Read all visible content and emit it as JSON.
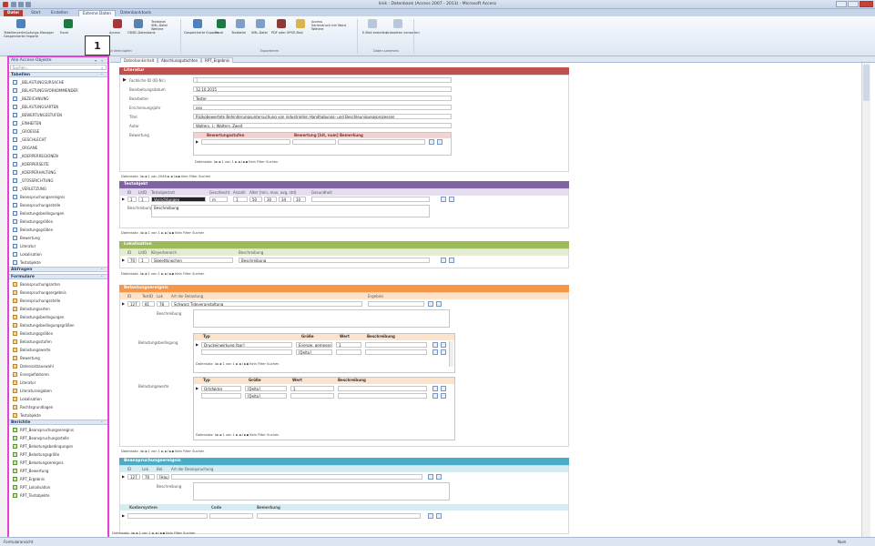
{
  "window": {
    "title": "linik : Datenbank (Access 2007 - 2013) - Microsoft Access"
  },
  "ribbon": {
    "tabs": [
      "Datei",
      "Start",
      "Erstellen",
      "Externe Daten",
      "Datenbanktools"
    ],
    "buttons": [
      "Gespeicherte Importe",
      "Tabellenverknüpfungs-Manager",
      "Excel",
      "Access",
      "ODBC-Datenbank",
      "Textdatei",
      "XML-Datei",
      "Weitere",
      "Gespeicherte Exporte",
      "Excel",
      "Textdatei",
      "XML-Datei",
      "PDF oder XPS",
      "E-Mail",
      "Access",
      "Seriendruck mit Word",
      "Weitere",
      "E-Mail erstellen",
      "Antworten verwalten"
    ],
    "groups": [
      "Importieren und Verknüpfen",
      "Exportieren",
      "Daten sammeln"
    ]
  },
  "callout": {
    "label": "1"
  },
  "nav": {
    "title": "Alle Access-Objekte",
    "search_placeholder": "Suchen...",
    "sections": [
      {
        "label": "Tabellen",
        "kind": "table",
        "items": [
          "_BELASTUNGSURSACHE",
          "_BELASTUNGSVORKOMMENDER",
          "_BEZEICHNUNG",
          "_BELASTUNGSARTEN",
          "_BEWERTUNGSSTUFEN",
          "_EINHEITEN",
          "_GROESSE",
          "_GESCHLECHT",
          "_ORGANE",
          "_KOERPERREGIONEN",
          "_KOERPERSEITE",
          "_KOERPERHALTUNG",
          "_STOSSRICHTUNG",
          "_VERLETZUNG",
          "Beanspruchungsereignis",
          "Beanspruchungsstelle",
          "Belastungsbedingungen",
          "Belastungsgrößen",
          "Belastungsgrößen",
          "Bewertung",
          "Literatur",
          "Lokalisation",
          "Testobjekte"
        ]
      },
      {
        "label": "Abfragen",
        "kind": "query",
        "items": []
      },
      {
        "label": "Formulare",
        "kind": "form",
        "items": [
          "Beanspruchungsarten",
          "Beanspruchungsergebnis",
          "Beanspruchungsstelle",
          "Belastungsarten",
          "Belastungsbedingungen",
          "Belastungsbedingungsgrößen",
          "Belastungsgrößen",
          "Belastungsstufen",
          "Belastungswerte",
          "Bewertung",
          "Datensatzauswahl",
          "Energiefaktoren",
          "Literatur",
          "Literaturangaben",
          "Lokalisation",
          "Rechtsgrundlagen",
          "Testobjekte"
        ]
      },
      {
        "label": "Berichte",
        "kind": "report",
        "items": [
          "RPT_Beanspruchungsereignis",
          "RPT_Beanspruchungsstelle",
          "RPT_Belastungsbedingungen",
          "RPT_Belastungsgröße",
          "RPT_Belastungsereignis",
          "RPT_Bewertung",
          "RPT_Ergebnis",
          "RPT_Lokalisation",
          "RPT_Testobjekte"
        ]
      }
    ]
  },
  "doc_tabs": [
    "Datenbankinhalt",
    "Abschlussgutachten",
    "RPT_Ergebnis"
  ],
  "form": {
    "literatur": {
      "header": "Literatur",
      "labels": [
        "Fachliche ID (ID-Nr.)",
        "Bearbeitungsdatum",
        "Bearbeiter",
        "Erscheinungsjahr",
        "Titel",
        "Autor",
        "Bewertung"
      ],
      "values": [
        "1",
        "12.10.2015",
        "Tester",
        "xxx",
        "Risikobewertete Behinderungsuntersuchung von industriellen Handhabungs- und Beschleunigungsprozessen",
        "Walters, J.; Walters, Zweit"
      ],
      "sub_cols": [
        "Bewertungsstufen",
        "Bewertung [bit, num]",
        "Bemerkung"
      ],
      "inner_nav": "Datensatz: I◄  ◄ 1 von 1  ► ►I ►▪  Kein Filter  Suchen",
      "outer_nav": "Datensatz: I◄  ◄ 1 von 2046  ► ►I ►▪  Kein Filter  Suchen"
    },
    "testobjekt": {
      "header": "Testobjekt",
      "cols": [
        "ID",
        "LitID",
        "Testobjektart",
        "Geschlecht",
        "Anzahl",
        "Alter [min, max, avg, std]",
        "Gesundheit"
      ],
      "row": [
        "1",
        "1",
        "Vorrichtungen",
        "m",
        "1",
        "50",
        "30",
        "34",
        "10"
      ],
      "desc_label": "Beschreibung",
      "desc_value": "Beschreibung",
      "nav": "Datensatz: I◄  ◄ 1 von 1  ► ►I ►▪  Kein Filter  Suchen"
    },
    "lokalisation": {
      "header": "Lokalisation",
      "cols": [
        "ID",
        "LitID",
        "Körperbereich",
        "Beschreibung"
      ],
      "row": [
        "70",
        "1",
        "Skelettknochen",
        "Beschreibung"
      ],
      "nav": "Datensatz: I◄  ◄ 1 von 1  ► ►I ►▪  Kein Filter  Suchen"
    },
    "belastung": {
      "header": "Belastungsereignis",
      "cols": [
        "ID",
        "TestID",
        "Lok",
        "Art der Belastung",
        "Ergebnis"
      ],
      "row": [
        "127",
        "81",
        "78",
        "Schwarz Tideveranstaltung"
      ],
      "labels": [
        "Beschreibung",
        "Belastungsbedingung",
        "Belastungswerte"
      ],
      "cond_cols": [
        "Typ",
        "Größe",
        "Wert",
        "Beschreibung"
      ],
      "cond_rows": [
        [
          "Druckeinwirkung [bar]",
          "Energie, gemessen",
          "1"
        ],
        [
          "",
          "[Delta]",
          ""
        ]
      ],
      "val_cols": [
        "Typ",
        "Größe",
        "Wert",
        "Beschreibung"
      ],
      "val_rows": [
        [
          "Ortsfaktor",
          "[Delta]",
          "1"
        ],
        [
          "",
          "[Delta]",
          ""
        ]
      ],
      "nav": "Datensatz: I◄  ◄ 1 von 1  ► ►I ►▪  Kein Filter  Suchen"
    },
    "beanspruchung": {
      "header": "Beanspruchungsereignis",
      "cols": [
        "ID",
        "Lok.",
        "Bel.",
        "Art der Beanspruchung"
      ],
      "row": [
        "127",
        "76",
        "[Hau]"
      ],
      "desc_label": "Beschreibung",
      "code_cols": [
        "Kodiersystem",
        "Code",
        "Bemerkung"
      ]
    },
    "bottom_nav": "Datensatz: I◄  ◄ 1 von 1  ► ►I ►▪  Kein Filter  Suchen"
  },
  "status": {
    "left": "Formularansicht",
    "right": "Num"
  },
  "colors": {
    "literatur": "#c0504d",
    "testobjekt": "#8064a2",
    "lokalisation": "#9bbb59",
    "belastung": "#f79646",
    "beanspruchung": "#4bacc6",
    "callout_border": "#e83fd6"
  }
}
